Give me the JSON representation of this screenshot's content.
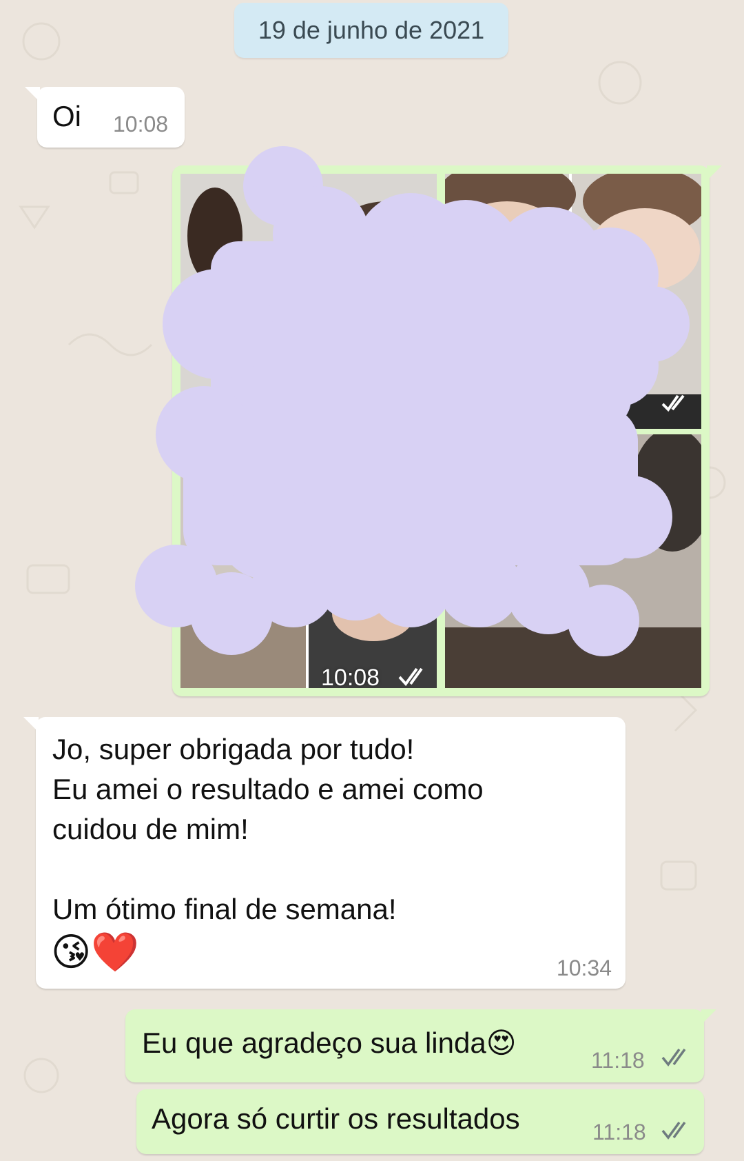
{
  "chat": {
    "date_chip": "19 de junho de 2021",
    "messages": [
      {
        "direction": "in",
        "text": "Oi",
        "time": "10:08"
      },
      {
        "direction": "out",
        "type": "photo_album",
        "time": "10:08",
        "status": "read"
      },
      {
        "direction": "in",
        "lines": [
          "Jo, super obrigada por tudo!",
          "Eu amei o resultado e amei como",
          "cuidou de mim!",
          "",
          "Um ótimo final de semana!"
        ],
        "emoji": "😘❤️",
        "time": "10:34"
      },
      {
        "direction": "out",
        "text": "Eu que agradeço sua linda😍",
        "time": "11:18",
        "status": "read"
      },
      {
        "direction": "out",
        "text": "Agora só curtir os resultados",
        "time": "11:18",
        "status": "read"
      }
    ]
  },
  "colors": {
    "background": "#ECE5DD",
    "incoming_bubble": "#FFFFFF",
    "outgoing_bubble": "#DCF8C6",
    "date_chip": "#D4EAF4",
    "redaction": "#D8D1F4",
    "read_ticks": "#6e7b7f"
  }
}
